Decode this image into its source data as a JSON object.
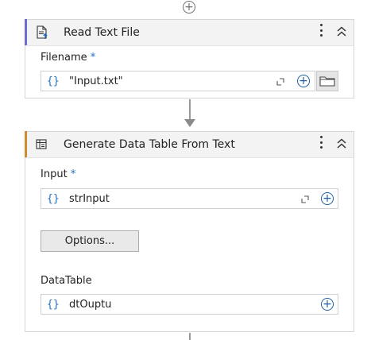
{
  "top_add": {
    "icon": "add-circle-icon",
    "glyph": "+"
  },
  "read_text_file": {
    "title": "Read Text File",
    "icon": "read-file-icon",
    "accent_color": "#6b6bd6",
    "filename_label": "Filename",
    "required_mark": "*",
    "filename_braces": "{}",
    "filename_value": "\"Input.txt\"",
    "plus_glyph": "+"
  },
  "generate_data_table": {
    "title": "Generate Data Table From Text",
    "icon": "data-table-icon",
    "accent_color": "#d08b2e",
    "input_label": "Input",
    "required_mark": "*",
    "input_braces": "{}",
    "input_value": "strInput",
    "options_button_label": "Options...",
    "datatable_label": "DataTable",
    "datatable_braces": "{}",
    "datatable_value": "dtOuptu",
    "plus_glyph": "+"
  }
}
